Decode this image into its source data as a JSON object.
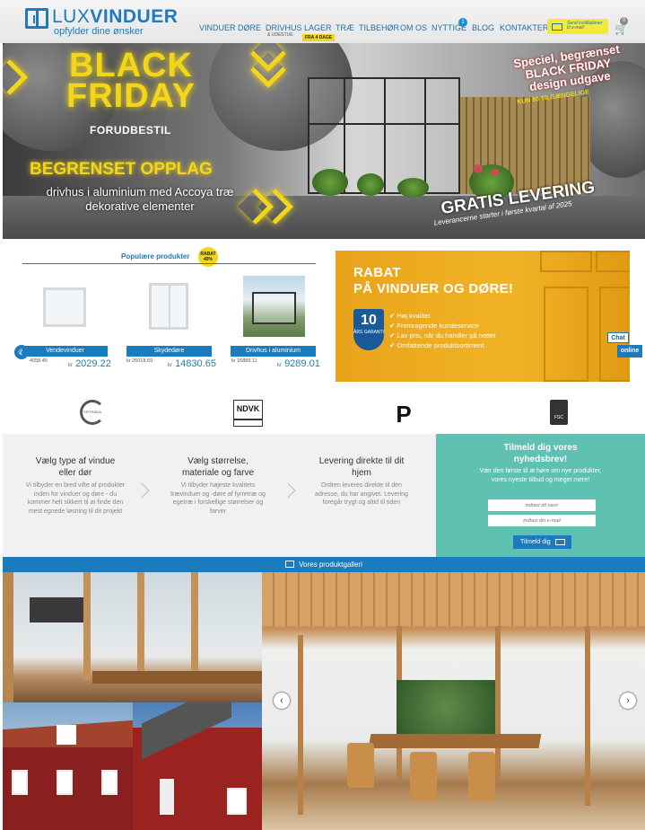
{
  "header": {
    "logo_light": "LUX",
    "logo_bold": "VINDUER",
    "tagline": "opfylder dine ønsker",
    "nav": [
      {
        "label": "VINDUER"
      },
      {
        "label": "DØRE"
      },
      {
        "label": "DRIVHUS",
        "sub": "& UDESTUE"
      },
      {
        "label": "LAGER",
        "badge": "FRA 4 DAGE"
      },
      {
        "label": "TRÆ"
      },
      {
        "label": "TILBEHØR"
      },
      {
        "label": "OM OS"
      },
      {
        "label": "NYTTIGE",
        "notification": "1"
      },
      {
        "label": "BLOG"
      },
      {
        "label": "KONTAKTER"
      }
    ],
    "newsletter_button": "Send instillationer til e-mail",
    "cart_count": "0"
  },
  "hero": {
    "black_friday": "BLACK FRIDAY",
    "preorder": "FORUDBESTIL",
    "limited": "BEGRENSET OPPLAG",
    "subtitle": "drivhus i aluminium med Accoya træ dekorative elementer",
    "special": "Speciel, begrænset BLACK FRIDAY design udgave",
    "only80": "KUN 80 TILGÆNGELIGE",
    "free_delivery": "GRATIS LEVERING",
    "delivery_note": "Leverancerne starter i første kvartal af 2025"
  },
  "popular": {
    "title": "Populære produkter",
    "badge": "RABAT 40%",
    "products": [
      {
        "name": "Vendevinduer",
        "old_price": "4058.45",
        "currency": "kr",
        "price": "2029.22"
      },
      {
        "name": "Skydedøre",
        "old_price": "kr 26018.69",
        "currency": "kr",
        "price": "14830.65"
      },
      {
        "name": "Drivhus i aluminium",
        "old_price": "kr 16889.11",
        "currency": "kr",
        "price": "9289.01"
      }
    ]
  },
  "promo": {
    "title_line1": "RABAT",
    "title_line2": "PÅ VINDUER OG DØRE!",
    "warranty_number": "10",
    "warranty_text": "ÅRS GARANTI",
    "bullets": [
      "Høj kvalitet",
      "Fremragende kundeservice",
      "Lav pris, når du handler på nettet",
      "Omfattende produktsortiment"
    ]
  },
  "chat": {
    "label": "Chat",
    "status": "online"
  },
  "certs": [
    {
      "name": "SP TRADA",
      "label": "SPITRADA"
    },
    {
      "name": "NDVK",
      "label": "NDVK"
    },
    {
      "name": "P",
      "label": "P"
    },
    {
      "name": "FSC",
      "label": "FSC"
    }
  ],
  "steps": [
    {
      "title": "Vælg type af vindue eller dør",
      "text": "Vi tilbyder en bred vifte af produkter inden for vinduer og døre - du kommer helt sikkert til at finde den mest egnede løsning til dit projekt"
    },
    {
      "title": "Vælg størrelse, materiale og farve",
      "text": "Vi tilbyder højeste kvalitets trævinduer og -døre af fyrretræ og egetræ i forskellige størrelser og farver"
    },
    {
      "title": "Levering direkte til dit hjem",
      "text": "Ordren leveres direkte til den adresse, du har angivet. Levering foregår trygt og altid til tiden"
    }
  ],
  "newsletter": {
    "title": "Tilmeld dig vores nyhedsbrev!",
    "text": "Vær den første til at høre om nye produkter, vores nyeste tilbud og meget mere!",
    "name_placeholder": "indtast dit navn",
    "email_placeholder": "indtast din e-mail",
    "button": "Tilmeld dig"
  },
  "gallery": {
    "title": "Vores produktgalleri",
    "prev": "‹",
    "next": "›"
  },
  "colors": {
    "brand_blue": "#1a7bbd",
    "accent_yellow": "#f3d61a",
    "promo_orange": "#f1b326",
    "newsletter_teal": "#5ec1b1"
  }
}
